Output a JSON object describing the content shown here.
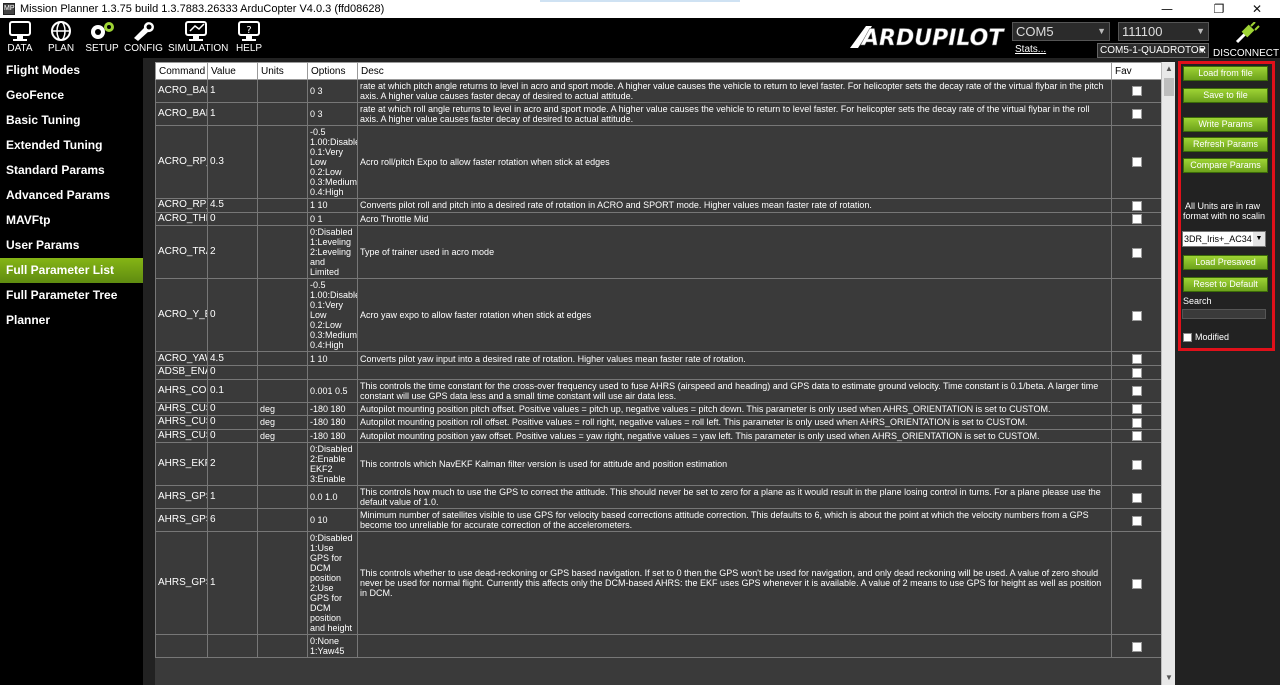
{
  "window": {
    "title": "Mission Planner 1.3.75 build 1.3.7883.26333 ArduCopter V4.0.3 (ffd08628)",
    "icon_text": "MP",
    "minimize": "—",
    "maximize": "❐",
    "close": "✕"
  },
  "toolbar": {
    "data": "DATA",
    "plan": "PLAN",
    "setup": "SETUP",
    "config": "CONFIG",
    "simulation": "SIMULATION",
    "help": "HELP",
    "logo_text": "ARDUPILOT",
    "port": "COM5",
    "baud": "111100",
    "stats": "Stats...",
    "vehicle": "COM5-1-QUADROTOR",
    "disconnect": "DISCONNECT"
  },
  "sidebar": {
    "items": [
      {
        "label": "Flight Modes"
      },
      {
        "label": "GeoFence"
      },
      {
        "label": "Basic Tuning"
      },
      {
        "label": "Extended Tuning"
      },
      {
        "label": "Standard Params"
      },
      {
        "label": "Advanced Params"
      },
      {
        "label": "MAVFtp"
      },
      {
        "label": "User Params"
      },
      {
        "label": "Full Parameter List"
      },
      {
        "label": "Full Parameter Tree"
      },
      {
        "label": "Planner"
      }
    ]
  },
  "table": {
    "headers": {
      "command": "Command",
      "value": "Value",
      "units": "Units",
      "options": "Options",
      "desc": "Desc",
      "fav": "Fav"
    },
    "rows": [
      {
        "command": "ACRO_BAL",
        "value": "1",
        "units": "",
        "options": "0 3",
        "desc": "rate at which pitch angle returns to level in acro and sport mode.  A higher value causes the vehicle to return to level faster. For helicopter sets the decay rate of the virtual flybar in the pitch axis. A higher value causes faster decay of desired to actual attitude."
      },
      {
        "command": "ACRO_BAL",
        "value": "1",
        "units": "",
        "options": "0 3",
        "desc": "rate at which roll angle returns to level in acro and sport mode.  A higher value causes the vehicle to return to level faster. For helicopter sets the decay rate of the virtual flybar in the roll axis. A higher value causes faster decay of desired to actual attitude."
      },
      {
        "command": "ACRO_RP_",
        "value": "0.3",
        "units": "",
        "options": "-0.5 1.00:Disable 0.1:Very Low 0.2:Low 0.3:Medium 0.4:High",
        "desc": "Acro roll/pitch Expo to allow faster rotation when stick at edges"
      },
      {
        "command": "ACRO_RP_",
        "value": "4.5",
        "units": "",
        "options": "1 10",
        "desc": "Converts pilot roll and pitch into a desired rate of rotation in ACRO and SPORT mode.  Higher values mean faster rate of rotation."
      },
      {
        "command": "ACRO_THR",
        "value": "0",
        "units": "",
        "options": "0 1",
        "desc": "Acro Throttle Mid"
      },
      {
        "command": "ACRO_TRA",
        "value": "2",
        "units": "",
        "options": "0:Disabled 1:Leveling 2:Leveling and Limited",
        "desc": "Type of trainer used in acro mode"
      },
      {
        "command": "ACRO_Y_E",
        "value": "0",
        "units": "",
        "options": "-0.5 1.00:Disable 0.1:Very Low 0.2:Low 0.3:Medium 0.4:High",
        "desc": "Acro yaw expo to allow faster rotation when stick at edges"
      },
      {
        "command": "ACRO_YAW",
        "value": "4.5",
        "units": "",
        "options": "1 10",
        "desc": "Converts pilot yaw input into a desired rate of rotation.  Higher values mean faster rate of rotation."
      },
      {
        "command": "ADSB_ENA",
        "value": "0",
        "units": "",
        "options": "",
        "desc": ""
      },
      {
        "command": "AHRS_COM",
        "value": "0.1",
        "units": "",
        "options": "0.001 0.5",
        "desc": "This controls the time constant for the cross-over frequency used to fuse AHRS (airspeed and heading) and GPS data to estimate ground velocity. Time constant is 0.1/beta. A larger time constant will use GPS data less and a small time constant will use air data less."
      },
      {
        "command": "AHRS_CUS",
        "value": "0",
        "units": "deg",
        "options": "-180 180",
        "desc": "Autopilot mounting position pitch offset. Positive values = pitch up, negative values = pitch down. This parameter is only used when AHRS_ORIENTATION is set to CUSTOM."
      },
      {
        "command": "AHRS_CUS",
        "value": "0",
        "units": "deg",
        "options": "-180 180",
        "desc": "Autopilot mounting position roll offset. Positive values = roll right, negative values = roll left. This parameter is only used when AHRS_ORIENTATION is set to CUSTOM."
      },
      {
        "command": "AHRS_CUS",
        "value": "0",
        "units": "deg",
        "options": "-180 180",
        "desc": "Autopilot mounting position yaw offset. Positive values = yaw right, negative values = yaw left. This parameter is only used when AHRS_ORIENTATION is set to CUSTOM."
      },
      {
        "command": "AHRS_EKF",
        "value": "2",
        "units": "",
        "options": "0:Disabled 2:Enable EKF2 3:Enable",
        "desc": "This controls which NavEKF Kalman filter version is used for attitude and position estimation"
      },
      {
        "command": "AHRS_GPS",
        "value": "1",
        "units": "",
        "options": "0.0 1.0",
        "desc": "This controls how much to use the GPS to correct the attitude. This should never be set to zero for a plane as it would result in the plane losing control in turns. For a plane please use the default value of 1.0."
      },
      {
        "command": "AHRS_GPS",
        "value": "6",
        "units": "",
        "options": "0 10",
        "desc": "Minimum number of satellites visible to use GPS for velocity based corrections attitude correction. This defaults to 6, which is about the point at which the velocity numbers from a GPS become too unreliable for accurate correction of the accelerometers."
      },
      {
        "command": "AHRS_GPS",
        "value": "1",
        "units": "",
        "options": "0:Disabled 1:Use GPS for DCM position 2:Use GPS for DCM position and height",
        "desc": "This controls whether to use dead-reckoning or GPS based navigation. If set to 0 then the GPS won't be used for navigation, and only dead reckoning will be used. A value of zero should never be used for normal flight. Currently this affects only the DCM-based AHRS: the EKF uses GPS whenever it is available. A value of 2 means to use GPS for height as well as position in DCM."
      },
      {
        "command": "",
        "value": "",
        "units": "",
        "options": "0:None 1:Yaw45",
        "desc": ""
      }
    ]
  },
  "right_panel": {
    "load_from_file": "Load from file",
    "save_to_file": "Save to file",
    "write_params": "Write Params",
    "refresh_params": "Refresh Params",
    "compare_params": "Compare Params",
    "units_note_1": "All Units are in raw",
    "units_note_2": "format with no scalin",
    "preset": "3DR_Iris+_AC34",
    "load_presaved": "Load Presaved",
    "reset_default": "Reset to Default",
    "search_label": "Search",
    "modified_label": "Modified"
  },
  "colors": {
    "highlight_border": "#e0101a",
    "active_green": "#85b515",
    "button_green": "#8cc42a"
  }
}
